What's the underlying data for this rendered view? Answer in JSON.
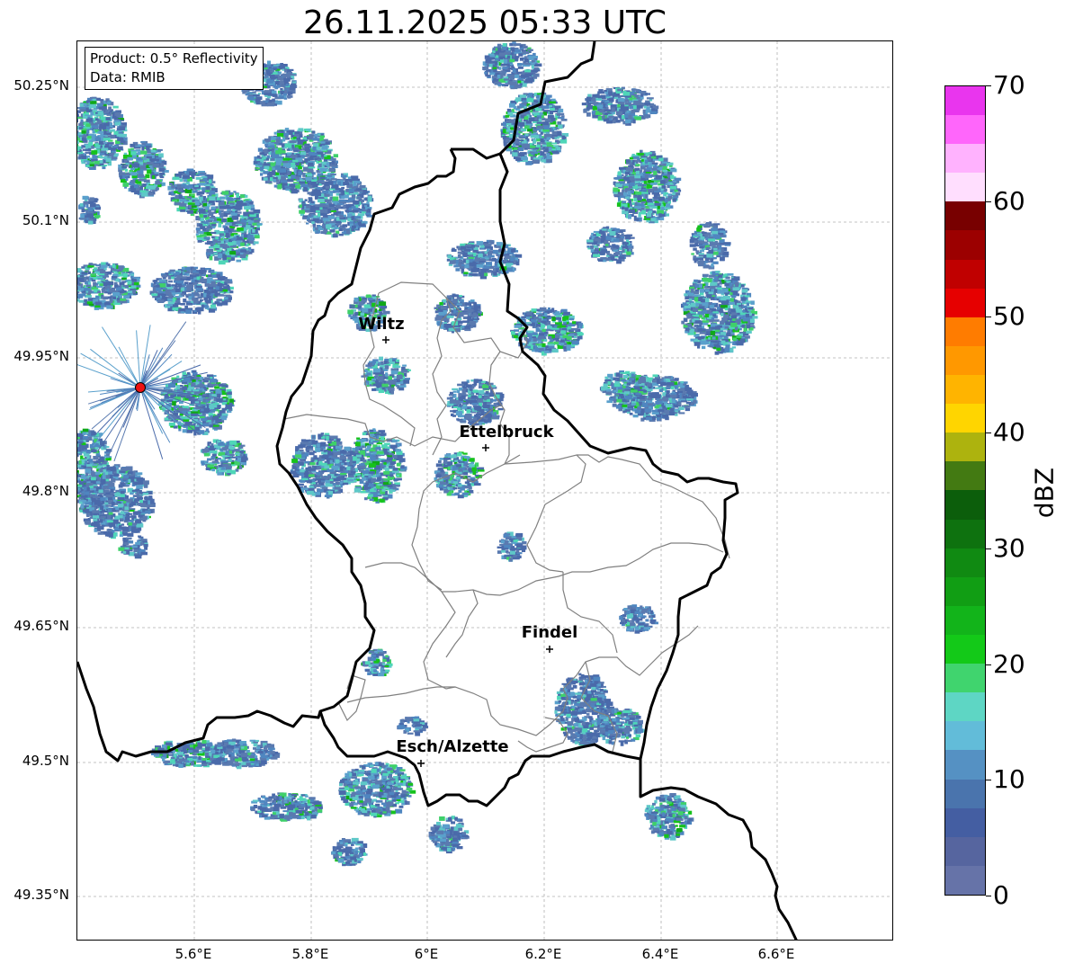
{
  "title": "26.11.2025 05:33 UTC",
  "info": {
    "product": "Product: 0.5° Reflectivity",
    "data": "Data: RMIB"
  },
  "lat_labels": [
    "50.25°N",
    "50.1°N",
    "49.95°N",
    "49.8°N",
    "49.65°N",
    "49.5°N",
    "49.35°N"
  ],
  "lon_labels": [
    "5.6°E",
    "5.8°E",
    "6°E",
    "6.2°E",
    "6.4°E",
    "6.6°E"
  ],
  "cities": [
    "Wiltz",
    "Ettelbruck",
    "Findel",
    "Esch/Alzette"
  ],
  "colorbar": {
    "label": "dBZ",
    "ticks": [
      "0",
      "10",
      "20",
      "30",
      "40",
      "50",
      "60",
      "70"
    ],
    "colors": [
      "#6673a8",
      "#56659f",
      "#445ea2",
      "#4a74ad",
      "#5591c3",
      "#62bcd9",
      "#5ed6c4",
      "#40d46e",
      "#13c918",
      "#12b41a",
      "#119e14",
      "#108a12",
      "#0e720f",
      "#0c5e0b",
      "#437a12",
      "#adb30e",
      "#ffd500",
      "#ffb400",
      "#ff9800",
      "#ff7c00",
      "#e60000",
      "#c00000",
      "#9c0000",
      "#780000",
      "#ffdefe",
      "#ffb2fe",
      "#ff66fb",
      "#e935ee"
    ]
  }
}
